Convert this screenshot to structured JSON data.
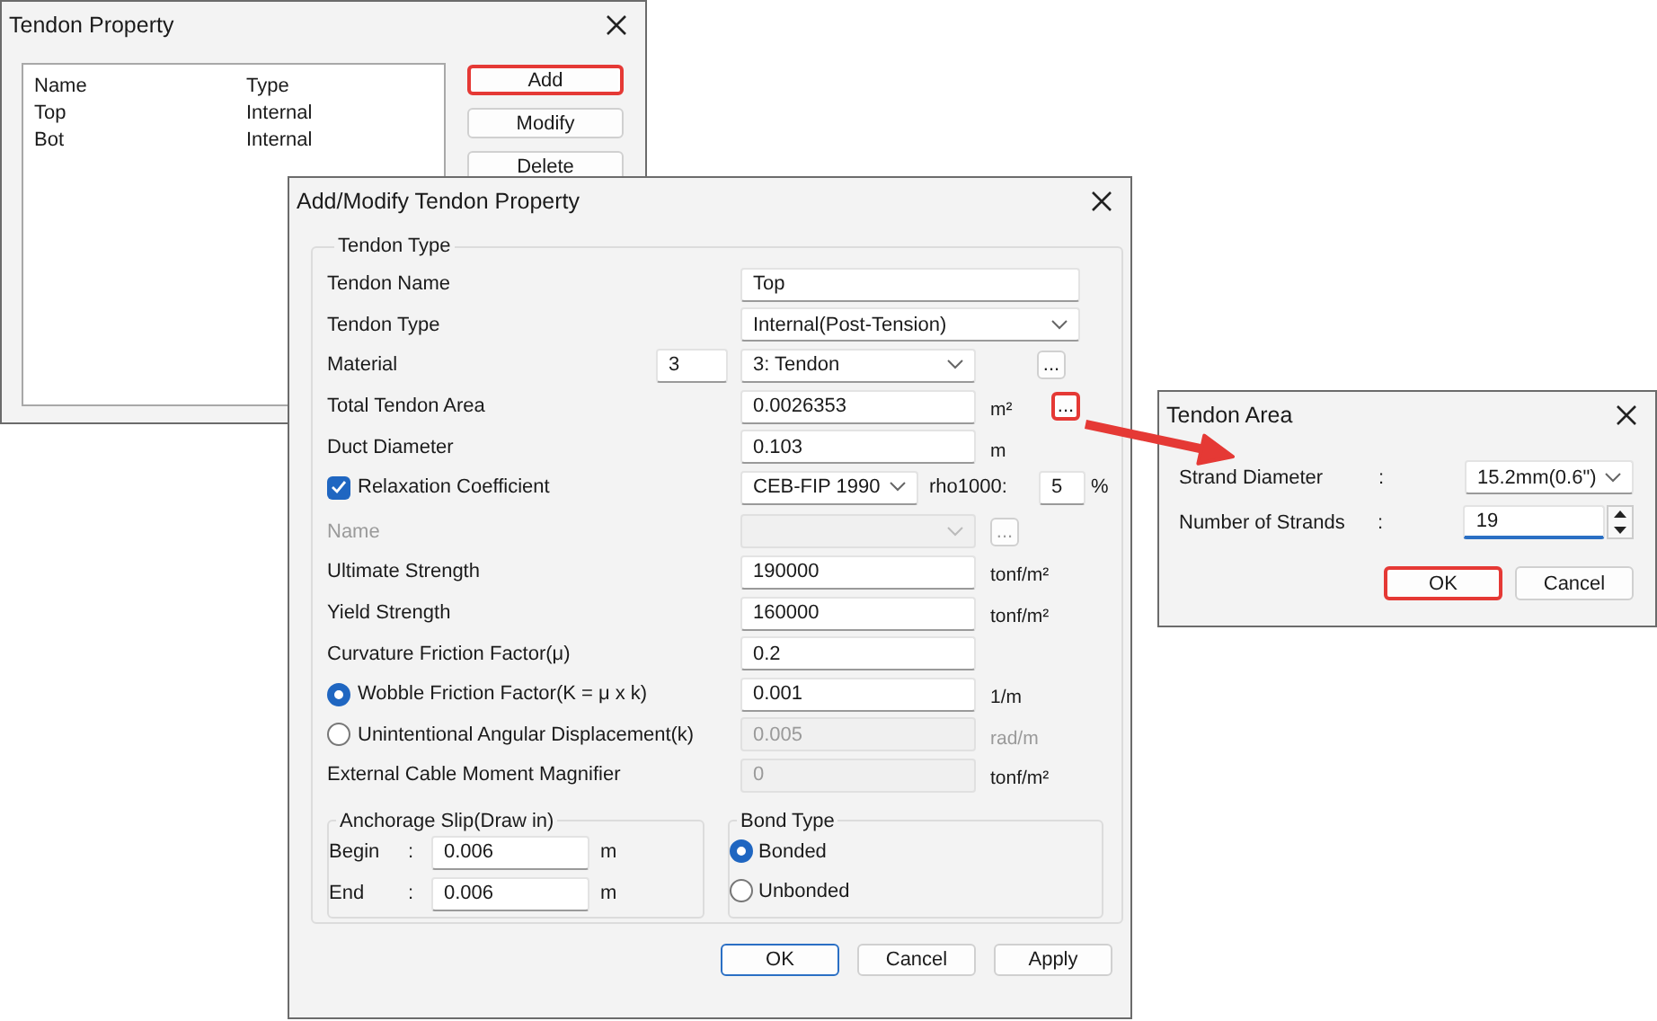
{
  "tendon_property_window": {
    "title": "Tendon Property",
    "list": {
      "columns": [
        "Name",
        "Type"
      ],
      "rows": [
        {
          "name": "Top",
          "type": "Internal"
        },
        {
          "name": "Bot",
          "type": "Internal"
        }
      ]
    },
    "buttons": [
      {
        "label": "Add",
        "highlighted": true
      },
      {
        "label": "Modify",
        "highlighted": false
      },
      {
        "label": "Delete",
        "highlighted": false
      }
    ]
  },
  "dialog": {
    "title": "Add/Modify Tendon Property",
    "group_title": "Tendon Type",
    "rows": [
      {
        "kind": "wide-text",
        "label": "Tendon Name",
        "value": "Top"
      },
      {
        "kind": "wide-select",
        "label": "Tendon Type",
        "value": "Internal(Post-Tension)"
      },
      {
        "kind": "material",
        "label": "Material",
        "number": "3",
        "value": "3: Tendon",
        "button": "..."
      },
      {
        "kind": "text",
        "label": "Total Tendon Area",
        "value": "0.0026353",
        "unit": "m²",
        "button": "...",
        "highlighted": true,
        "disabled": false
      },
      {
        "kind": "text",
        "label": "Duct Diameter",
        "value": "0.103",
        "unit": "m",
        "disabled": false
      },
      {
        "kind": "check",
        "label": "Relaxation Coefficient",
        "checked": true,
        "value": "CEB-FIP 1990",
        "extra_label": "rho1000:",
        "extra_value": "5",
        "unit": "%"
      },
      {
        "kind": "disabled-select",
        "label": "Name",
        "button": "..."
      },
      {
        "kind": "text",
        "label": "Ultimate Strength",
        "value": "190000",
        "unit": "tonf/m²",
        "disabled": false
      },
      {
        "kind": "text",
        "label": "Yield Strength",
        "value": "160000",
        "unit": "tonf/m²",
        "disabled": false
      },
      {
        "kind": "text",
        "label": "Curvature Friction Factor(μ)",
        "value": "0.2",
        "disabled": false
      },
      {
        "kind": "radio",
        "label": "Wobble Friction Factor(K = μ x k)",
        "selected": true,
        "value": "0.001",
        "unit": "1/m"
      },
      {
        "kind": "radio",
        "label": "Unintentional Angular Displacement(k)",
        "selected": false,
        "value": "0.005",
        "unit": "rad/m"
      },
      {
        "kind": "text",
        "label": "External Cable Moment Magnifier",
        "value": "0",
        "unit": "tonf/m²",
        "disabled": true
      }
    ],
    "anchorage_slip": {
      "title": "Anchorage Slip(Draw in)",
      "rows": [
        {
          "label": "Begin",
          "separator": ":",
          "value": "0.006",
          "unit": "m"
        },
        {
          "label": "End",
          "separator": ":",
          "value": "0.006",
          "unit": "m"
        }
      ]
    },
    "bond_type": {
      "title": "Bond Type",
      "options": [
        {
          "label": "Bonded",
          "selected": true
        },
        {
          "label": "Unbonded",
          "selected": false
        }
      ]
    },
    "buttons": [
      {
        "label": "OK",
        "default": true
      },
      {
        "label": "Cancel",
        "default": false
      },
      {
        "label": "Apply",
        "default": false
      }
    ]
  },
  "tendon_area_window": {
    "title": "Tendon Area",
    "rows": [
      {
        "kind": "select",
        "label": "Strand Diameter",
        "separator": ":",
        "value": "15.2mm(0.6\")"
      },
      {
        "kind": "spinner",
        "label": "Number of Strands",
        "separator": ":",
        "value": "19"
      }
    ],
    "buttons": [
      {
        "label": "OK",
        "highlighted": true
      },
      {
        "label": "Cancel",
        "highlighted": false
      }
    ]
  }
}
